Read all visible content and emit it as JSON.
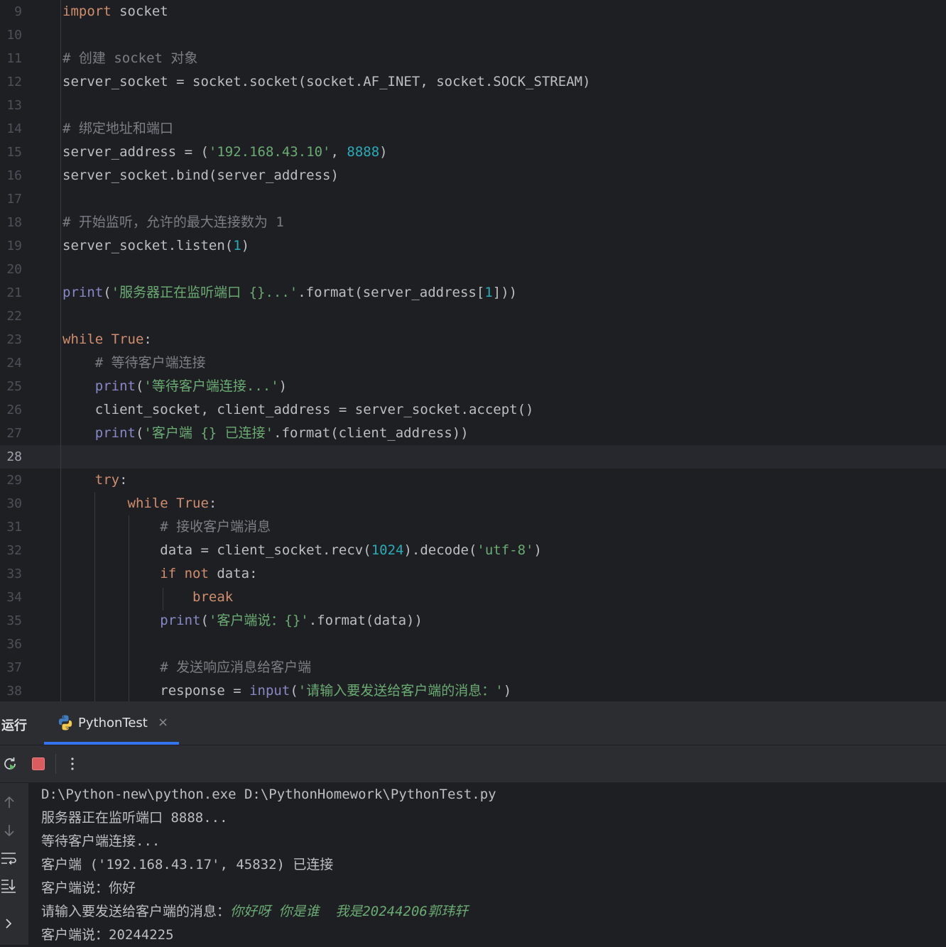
{
  "editor": {
    "lines": [
      {
        "n": "9",
        "html": "<span class=\"kw\">import</span> socket"
      },
      {
        "n": "10",
        "html": ""
      },
      {
        "n": "11",
        "html": "<span class=\"com\"># <span class=\"cjk\">创建</span> socket <span class=\"cjk\">对象</span></span>"
      },
      {
        "n": "12",
        "html": "server_socket = socket.socket(socket.AF_INET, socket.SOCK_STREAM)"
      },
      {
        "n": "13",
        "html": ""
      },
      {
        "n": "14",
        "html": "<span class=\"com\"># <span class=\"cjk\">绑定地址和端口</span></span>"
      },
      {
        "n": "15",
        "html": "server_address = (<span class=\"str\">'192.168.43.10'</span>, <span class=\"num\">8888</span>)"
      },
      {
        "n": "16",
        "html": "server_socket.bind(server_address)"
      },
      {
        "n": "17",
        "html": ""
      },
      {
        "n": "18",
        "html": "<span class=\"com\"># <span class=\"cjk\">开始监听，允许的最大连接数为</span> 1</span>"
      },
      {
        "n": "19",
        "html": "server_socket.listen(<span class=\"num\">1</span>)"
      },
      {
        "n": "20",
        "html": ""
      },
      {
        "n": "21",
        "html": "<span class=\"bi\">print</span>(<span class=\"str\">'<span class=\"cjk\">服务器正在监听端口</span> {}...'</span>.format(server_address[<span class=\"num\">1</span>]))"
      },
      {
        "n": "22",
        "html": ""
      },
      {
        "n": "23",
        "html": "<span class=\"kw\">while True</span>:"
      },
      {
        "n": "24",
        "html": "    <span class=\"com\"># <span class=\"cjk\">等待客户端连接</span></span>"
      },
      {
        "n": "25",
        "html": "    <span class=\"bi\">print</span>(<span class=\"str\">'<span class=\"cjk\">等待客户端连接</span>...'</span>)"
      },
      {
        "n": "26",
        "html": "    client_socket, client_address = server_socket.accept()"
      },
      {
        "n": "27",
        "html": "    <span class=\"bi\">print</span>(<span class=\"str\">'<span class=\"cjk\">客户端</span> {} <span class=\"cjk\">已连接</span>'</span>.format(client_address))"
      },
      {
        "n": "28",
        "html": "",
        "current": true
      },
      {
        "n": "29",
        "html": "    <span class=\"kw\">try</span>:"
      },
      {
        "n": "30",
        "html": "        <span class=\"kw\">while True</span>:"
      },
      {
        "n": "31",
        "html": "            <span class=\"com\"># <span class=\"cjk\">接收客户端消息</span></span>"
      },
      {
        "n": "32",
        "html": "            data = client_socket.recv(<span class=\"num\">1024</span>).decode(<span class=\"str\">'utf-8'</span>)"
      },
      {
        "n": "33",
        "html": "            <span class=\"kw\">if not</span> data:"
      },
      {
        "n": "34",
        "html": "                <span class=\"kw\">break</span>"
      },
      {
        "n": "35",
        "html": "            <span class=\"bi\">print</span>(<span class=\"str\">'<span class=\"cjk\">客户端说：</span>{}'</span>.format(data))"
      },
      {
        "n": "36",
        "html": ""
      },
      {
        "n": "37",
        "html": "            <span class=\"com\"># <span class=\"cjk\">发送响应消息给客户端</span></span>"
      },
      {
        "n": "38",
        "html": "            response = <span class=\"bi\">input</span>(<span class=\"str\">'<span class=\"cjk\">请输入要发送给客户端的消息：</span>'</span>)"
      }
    ]
  },
  "run_panel": {
    "title": "运行",
    "tab_label": "PythonTest",
    "close_glyph": "×",
    "console": {
      "lines": [
        {
          "text": "D:\\Python-new\\python.exe D:\\PythonHomework\\PythonTest.py"
        },
        {
          "text": "服务器正在监听端口 8888..."
        },
        {
          "text": "等待客户端连接..."
        },
        {
          "text": "客户端 ('192.168.43.17', 45832) 已连接"
        },
        {
          "text": "客户端说：你好"
        },
        {
          "text": "请输入要发送给客户端的消息：",
          "input": "你好呀 你是谁  我是20244206郭玮轩"
        },
        {
          "text": "客户端说：20244225"
        }
      ]
    }
  },
  "icons": [
    "rerun-icon",
    "stop-icon",
    "more-options-icon",
    "scroll-up-icon",
    "scroll-down-icon",
    "soft-wrap-icon",
    "scroll-to-end-icon",
    "expand-icon",
    "python-icon"
  ],
  "colors": {
    "background": "#1e1f22",
    "keyword": "#cf8e6d",
    "builtin": "#8888c6",
    "string": "#6aab73",
    "number": "#2aacb8",
    "comment": "#7a7e85",
    "accent": "#3574f0",
    "stop": "#db5c5c"
  }
}
